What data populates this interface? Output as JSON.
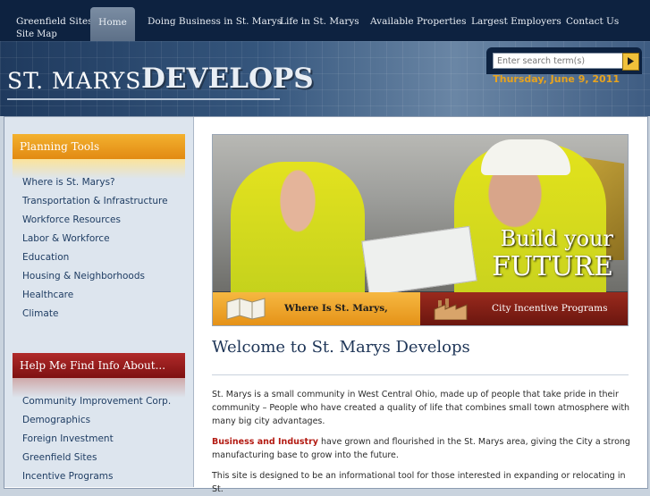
{
  "nav": {
    "items": [
      "Greenfield Sites",
      "Home",
      "Doing Business in St. Marys",
      "Life in St. Marys",
      "Available Properties",
      "Largest Employers",
      "Contact Us"
    ],
    "sitemap": "Site Map"
  },
  "banner": {
    "logo_part1": "ST. MARYS",
    "logo_part2": "DEVELOPS",
    "date": "Thursday, June 9, 2011",
    "search_placeholder": "Enter search term(s)"
  },
  "sidebar": {
    "planning_title": "Planning Tools",
    "planning_items": [
      "Where is St. Marys?",
      "Transportation & Infrastructure",
      "Workforce Resources",
      "Labor & Workforce",
      "Education",
      "Housing & Neighborhoods",
      "Healthcare",
      "Climate"
    ],
    "help_title": "Help Me Find Info About...",
    "help_items": [
      "Community Improvement Corp.",
      "Demographics",
      "Foreign Investment",
      "Greenfield Sites",
      "Incentive Programs"
    ]
  },
  "hero": {
    "tag_line1": "Build your",
    "tag_line2": "FUTURE",
    "btn_left": "Where Is St. Marys, Ohio?",
    "btn_right": "City Incentive Programs"
  },
  "main": {
    "title": "Welcome to St. Marys Develops",
    "para1": "St. Marys is a small community in West Central Ohio, made up of people that take pride in their community – People who have created a quality of life that combines small town atmosphere with many big city advantages.",
    "para2_highlight": "Business and Industry",
    "para2_rest": " have grown and flourished in the St. Marys area, giving the City a strong manufacturing base to grow into the future.",
    "para3": "This site is designed to be an informational tool for those interested in expanding or relocating in St."
  },
  "colors": {
    "nav_bg": "#0d2240",
    "accent_orange": "#e8a31d",
    "accent_red": "#8f1b1b"
  }
}
